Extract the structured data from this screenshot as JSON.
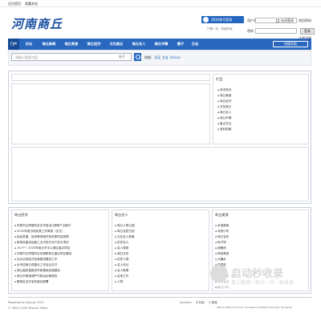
{
  "topbar": {
    "links": [
      "设为首页",
      "收藏本站"
    ]
  },
  "logo": {
    "text": "河南商丘"
  },
  "login": {
    "qq_button": "用QQ帐号登录",
    "qq_tip": "只需一步，快速开始",
    "username_label": "用户名",
    "password_label": "密码",
    "remember_label": "自动登录",
    "forgot_link": "找回密码",
    "register_link": "立即注册",
    "login_button": "登录"
  },
  "nav": {
    "items": [
      "门户",
      "论坛",
      "商丘新闻",
      "商丘美食",
      "商丘经济",
      "文化商丘",
      "商丘名人",
      "商丘市情",
      "圈子",
      "日志"
    ],
    "active_index": 0,
    "quick_nav": "快捷导航"
  },
  "search": {
    "placeholder": "请输入搜索内容",
    "type": "帖子",
    "hot_label": "热搜:",
    "hot_items": [
      "活动",
      "交友",
      "discuz"
    ]
  },
  "sidebar": {
    "title": "栏目",
    "items": [
      "资讯快讯",
      "商丘美食",
      "商丘经济",
      "文化商丘",
      "商丘名人",
      "商丘市情",
      "重点关注",
      "资料档案"
    ]
  },
  "sections": {
    "economy": {
      "title": "商丘经济",
      "items": [
        "市委书记李建华走访市县(区)调研产业振兴",
        "2025年度当地民营工作简报（全文）",
        "民权发展、投资等领域开放改革项目政策",
        "新常态建设运营工业中的文化产品与项目",
        "147个！2025年商丘市中心城区重点项目",
        "市委书记李建华走访调研商丘重点项目建设",
        "加大沿线经济全面推进建设工作",
        "全市招商引资重点工作会议召开",
        "商丘高质量推进市政基础设施建设",
        "商丘市委强调严守政治纪律规范",
        "睢阳区召开宣传座谈部署"
      ]
    },
    "famous": {
      "title": "商丘名人",
      "items": [
        "商丘人物公园",
        "商丘名胜古迹",
        "文化名人故事",
        "历史名人",
        "名人故居",
        "商丘文化",
        "历史人物",
        "名人传记",
        "名人轶事",
        "名家之作",
        "人物"
      ]
    },
    "food": {
      "title": "商丘美食",
      "items": [
        "永城美食",
        "传统小吃",
        "地方名吃",
        "垛子饼",
        "胡辣汤",
        "风味美食",
        "大糖水",
        "豆腐皮",
        "地方菜",
        "商丘美食（全）",
        "商丘名店",
        "商丘小吃"
      ],
      "gray_from": 9
    }
  },
  "footer": {
    "powered": "Powered by Discuz! X3.5",
    "copyright": "© 2001-2025 Discuz! Team.",
    "links": [
      "Archiver",
      "手机版",
      "小黑屋"
    ],
    "stats": "GMT+8, 2025-2-27 07:44 , Processed in 0.042217 second(s), 20 queries ."
  },
  "watermark": {
    "text": "自动秒收录",
    "sub": "做上链接一来访一次一秒收录"
  }
}
